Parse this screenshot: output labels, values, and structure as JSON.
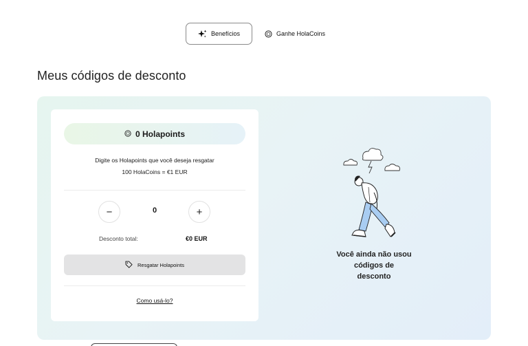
{
  "tabs": [
    {
      "label": "Benefícios",
      "icon": "sparkles-icon",
      "active": true
    },
    {
      "label": "Ganhe HolaCoins",
      "icon": "coin-icon",
      "active": false
    }
  ],
  "page_title": "Meus códigos de desconto",
  "card": {
    "points_label": "0 Holapoints",
    "instruction_line1": "Digite os Holapoints que você deseja resgatar",
    "instruction_line2": "100 HolaCoins = €1 EUR",
    "decrement_label": "−",
    "quantity": "0",
    "increment_label": "+",
    "total_label": "Desconto total:",
    "total_value": "€0 EUR",
    "redeem_label": "Resgatar Holapoints",
    "howto_label": "Como usá-lo?"
  },
  "empty_state": {
    "line1": "Você ainda não usou",
    "line2": "códigos de",
    "line3": "desconto"
  },
  "colors": {
    "panel_start": "#e6f5ef",
    "panel_end": "#e3eef9",
    "pill_start": "#e9f6e6",
    "button_bg": "#e3e3e4",
    "illustration_blue": "#a9cdf2"
  }
}
